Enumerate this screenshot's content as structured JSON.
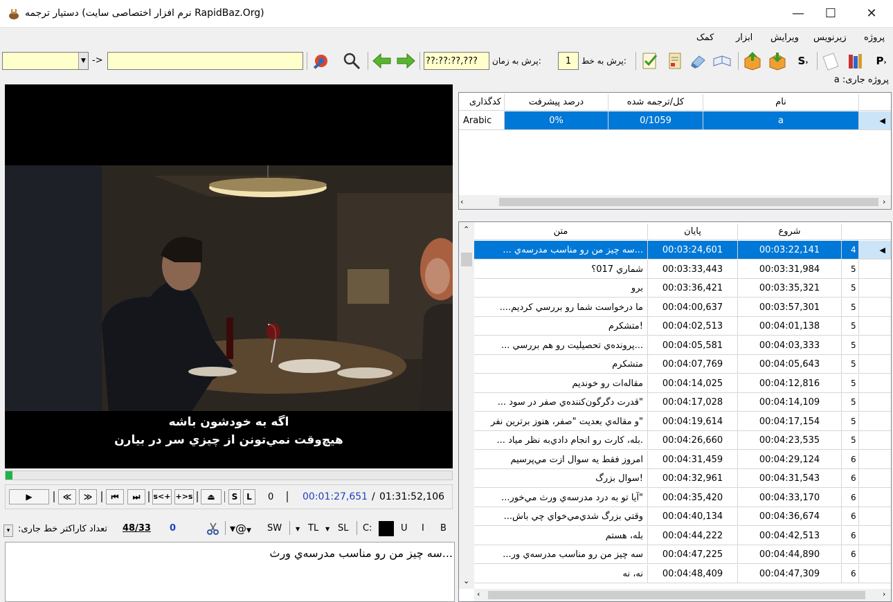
{
  "window": {
    "title": "دستیار ترجمه (نرم افزار اختصاصی سایت RapidBaz.Org)",
    "minimize": "—",
    "maximize": "☐",
    "close": "✕"
  },
  "menu": [
    "پروژه",
    "زیرنویس",
    "ویرایش",
    "ابزار",
    "کمک"
  ],
  "toolbar": {
    "search_value": "",
    "arrow": "->",
    "replace_value": "",
    "time_value": "??:??:??,???",
    "jump_time_label": "پرش به زمان:",
    "line_value": "1",
    "jump_line_label": "پرش به خط:"
  },
  "current_project_label": "پروژه جاری: a",
  "project_table": {
    "headers": [
      "نام",
      "کل/ترجمه شده",
      "درصد پیشرفت",
      "کدگذاری"
    ],
    "rows": [
      {
        "name": "a",
        "total": "0/1059",
        "progress": "0%",
        "encoding": "Arabic"
      }
    ]
  },
  "subtitle_table": {
    "headers": [
      "شروع",
      "پایان",
      "متن"
    ],
    "rows": [
      {
        "num": "4",
        "start": "00:03:22,141",
        "end": "00:03:24,601",
        "text": "...سه چیز من رو مناسب مدرسه‌ي ..."
      },
      {
        "num": "5",
        "start": "00:03:31,984",
        "end": "00:03:33,443",
        "text": "شماري 017؟"
      },
      {
        "num": "5",
        "start": "00:03:35,321",
        "end": "00:03:36,421",
        "text": "برو"
      },
      {
        "num": "5",
        "start": "00:03:57,301",
        "end": "00:04:00,637",
        "text": "ما درخواست شما رو بررسي کرديم...."
      },
      {
        "num": "5",
        "start": "00:04:01,138",
        "end": "00:04:02,513",
        "text": "!متشکرم"
      },
      {
        "num": "5",
        "start": "00:04:03,333",
        "end": "00:04:05,581",
        "text": "...پرونده‌ي تحصيليت رو هم بررسي ..."
      },
      {
        "num": "5",
        "start": "00:04:05,643",
        "end": "00:04:07,769",
        "text": "متشکرم"
      },
      {
        "num": "5",
        "start": "00:04:12,816",
        "end": "00:04:14,025",
        "text": "مقاله‌ات رو خونديم"
      },
      {
        "num": "5",
        "start": "00:04:14,109",
        "end": "00:04:17,028",
        "text": "\"قدرت دگرگون‌کننده‌ي صفر در سود ..."
      },
      {
        "num": "5",
        "start": "00:04:17,154",
        "end": "00:04:19,614",
        "text": "\"و مقاله‌ي بعديت \"صفر، هنوز برترين نفر"
      },
      {
        "num": "5",
        "start": "00:04:23,535",
        "end": "00:04:26,660",
        "text": ".بله، کارت رو انجام دادي‌به نظر مياد ..."
      },
      {
        "num": "6",
        "start": "00:04:29,124",
        "end": "00:04:31,459",
        "text": "امروز فقط يه سوال ازت مي‌پرسيم"
      },
      {
        "num": "6",
        "start": "00:04:31,543",
        "end": "00:04:32,961",
        "text": "!سوال بزرگ"
      },
      {
        "num": "6",
        "start": "00:04:33,170",
        "end": "00:04:35,420",
        "text": "\"آيا تو به درد مدرسه‌ي ورث مي‌خور..."
      },
      {
        "num": "6",
        "start": "00:04:36,674",
        "end": "00:04:40,134",
        "text": "وقتي بزرگ شدي‌مي‌خواي چي باش..."
      },
      {
        "num": "6",
        "start": "00:04:42,513",
        "end": "00:04:44,222",
        "text": "بله، هستم"
      },
      {
        "num": "6",
        "start": "00:04:44,890",
        "end": "00:04:47,225",
        "text": "سه چيز من رو مناسب مدرسه‌ي ور..."
      },
      {
        "num": "6",
        "start": "00:04:47,309",
        "end": "00:04:48,409",
        "text": "نه، نه"
      }
    ]
  },
  "video": {
    "subtitle_line1": "اگه به خودشون باشه",
    "subtitle_line2": "هيچ‌وقت نمي‌تونن از چيزي سر در بيارن",
    "progress": 0.016
  },
  "controls": {
    "buttons": [
      "▶",
      "≪",
      "≫",
      "⏮",
      "⏭",
      "s<+",
      "+>s",
      "⏏",
      "S",
      "L"
    ],
    "counter": "0",
    "current_time": "00:01:27,651",
    "separator": "/",
    "total_time": "01:31:52,106"
  },
  "edit_toolbar": {
    "char_count_label": "تعداد کاراکتر خط جاری:",
    "char_count_value": "48/33",
    "zero_value": "0",
    "sw": "SW",
    "tl": "TL",
    "sl": "SL",
    "c_label": "C:",
    "u": "U",
    "i": "I",
    "b": "B"
  },
  "editor_text": "سه چیز من رو مناسب مدرسه‌ي ورث..."
}
